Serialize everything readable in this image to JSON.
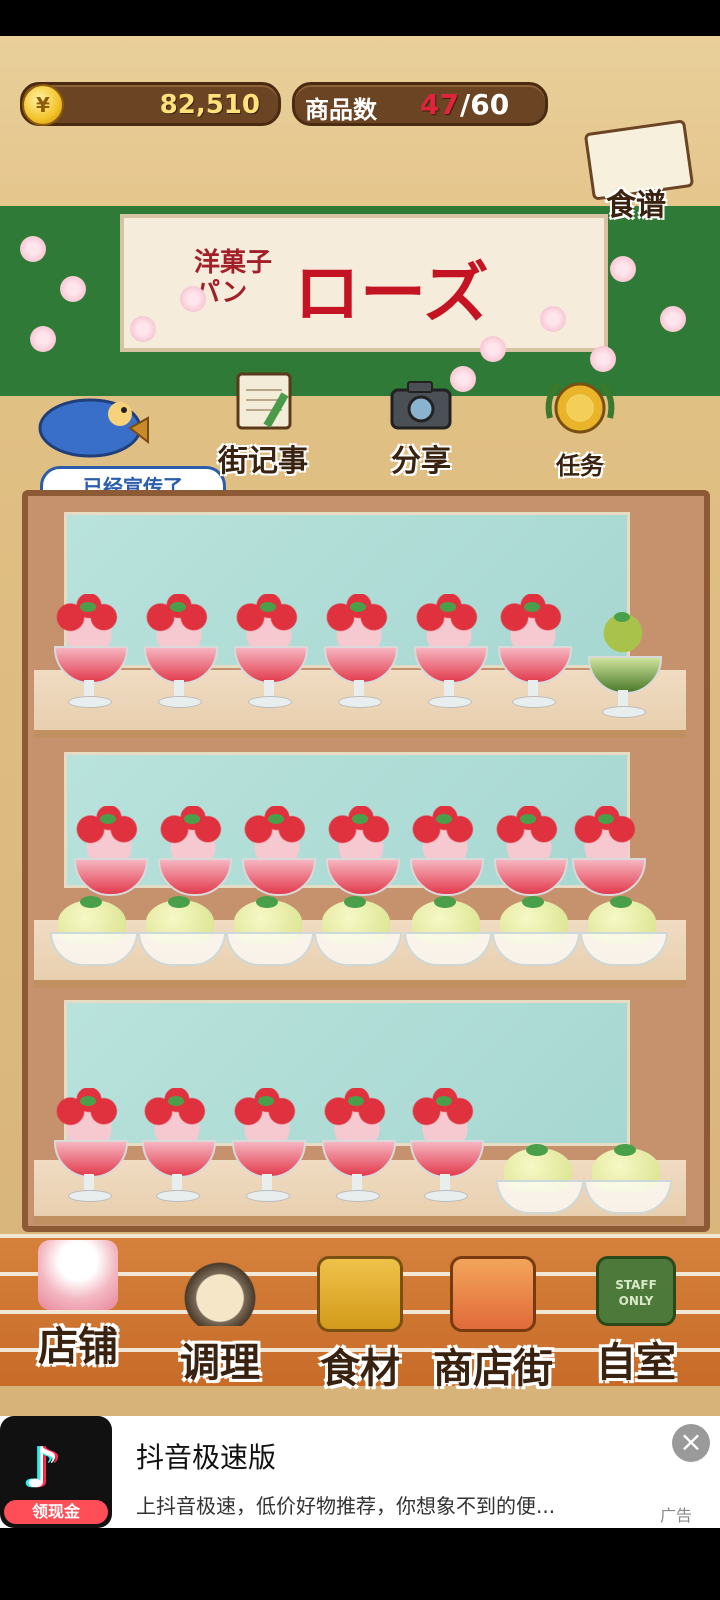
{
  "hud": {
    "coin_symbol": "¥",
    "coins": "82,510",
    "items_label": "商品数",
    "items_count": "47",
    "items_max": "/60"
  },
  "recipe": {
    "label": "食谱"
  },
  "shop_sign": {
    "small_line1": "洋菓子",
    "small_line2": "パン",
    "name": "ローズ"
  },
  "toolbar": {
    "bird_bubble": "已经宣传了",
    "street_news": "街记事",
    "share": "分享",
    "missions": "任务"
  },
  "nav": {
    "store": "店铺",
    "cooking": "调理",
    "ingredients": "食材",
    "shopping_street": "商店街",
    "my_room": "自室",
    "staff_sign": "STAFF ONLY"
  },
  "ad": {
    "badge": "领现金",
    "title": "抖音极速版",
    "description": "上抖音极速，低价好物推荐，你想象不到的便...",
    "tag": "广告",
    "close": "×"
  }
}
